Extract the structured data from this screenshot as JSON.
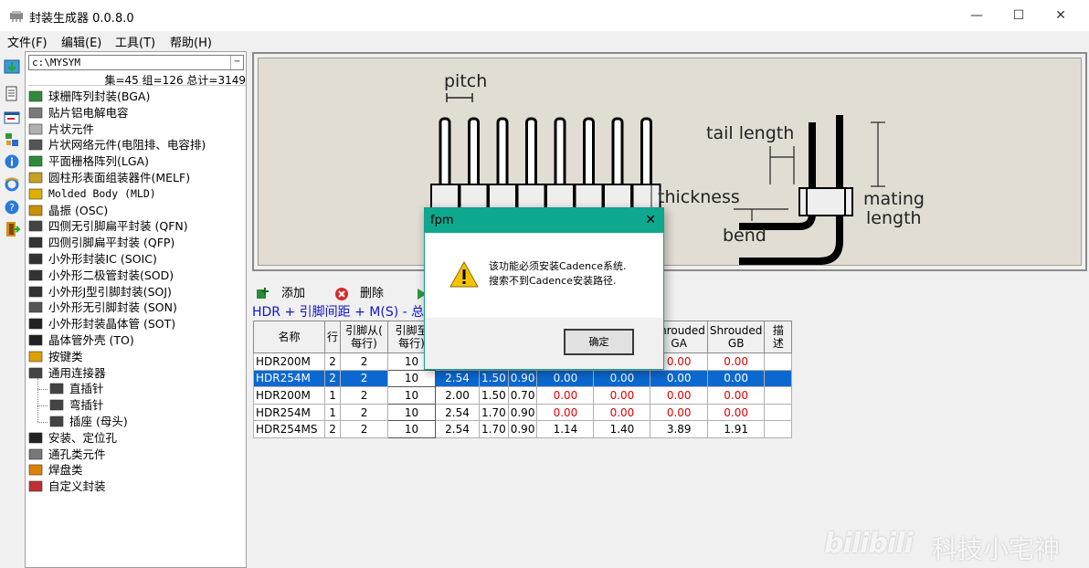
{
  "window": {
    "title": "封装生成器 0.0.8.0",
    "minimize": "—",
    "maximize": "☐",
    "close": "✕"
  },
  "menu": [
    "文件(F)",
    "编辑(E)",
    "工具(T)",
    "帮助(H)"
  ],
  "path": {
    "value": "c:\\MYSYM"
  },
  "stats": "集=45 组=126 总计=3149",
  "tree": [
    {
      "label": "球栅阵列封装(BGA)",
      "icon": "bga-icon",
      "color": "#2e8b3a"
    },
    {
      "label": "贴片铝电解电容",
      "icon": "capacitor-icon",
      "color": "#7a7a7a"
    },
    {
      "label": "片状元件",
      "icon": "chip-icon",
      "color": "#b0b0b0"
    },
    {
      "label": "片状网络元件(电阻排、电容排)",
      "icon": "network-icon",
      "color": "#555555"
    },
    {
      "label": "平面栅格阵列(LGA)",
      "icon": "lga-icon",
      "color": "#2e8b3a"
    },
    {
      "label": "圆柱形表面组装器件(MELF)",
      "icon": "melf-icon",
      "color": "#c8a020"
    },
    {
      "label": "Molded Body (MLD)",
      "icon": "molded-icon",
      "color": "#e0b000",
      "mono": true
    },
    {
      "label": "晶振 (OSC)",
      "icon": "osc-icon",
      "color": "#c89000"
    },
    {
      "label": "四侧无引脚扁平封装 (QFN)",
      "icon": "qfn-icon",
      "color": "#444444"
    },
    {
      "label": "四侧引脚扁平封装 (QFP)",
      "icon": "qfp-icon",
      "color": "#333333"
    },
    {
      "label": "小外形封装IC (SOIC)",
      "icon": "soic-icon",
      "color": "#333333"
    },
    {
      "label": "小外形二极管封装(SOD)",
      "icon": "sod-icon",
      "color": "#333333"
    },
    {
      "label": "小外形J型引脚封装(SOJ)",
      "icon": "soj-icon",
      "color": "#333333"
    },
    {
      "label": "小外形无引脚封装 (SON)",
      "icon": "son-icon",
      "color": "#555555"
    },
    {
      "label": "小外形封装晶体管 (SOT)",
      "icon": "sot-icon",
      "color": "#222222"
    },
    {
      "label": "晶体管外壳 (TO)",
      "icon": "to-icon",
      "color": "#222222"
    },
    {
      "label": "按键类",
      "icon": "button-icon",
      "color": "#e0a000"
    },
    {
      "label": "通用连接器",
      "icon": "connector-icon",
      "color": "#444444"
    },
    {
      "label": "直插针",
      "icon": "straight-pin-icon",
      "color": "#444444",
      "child": true
    },
    {
      "label": "弯插针",
      "icon": "bent-pin-icon",
      "color": "#444444",
      "child": true
    },
    {
      "label": "插座 (母头)",
      "icon": "socket-icon",
      "color": "#444444",
      "child": true
    },
    {
      "label": "安装、定位孔",
      "icon": "mounting-hole-icon",
      "color": "#222222"
    },
    {
      "label": "通孔类元件",
      "icon": "through-hole-icon",
      "color": "#777777"
    },
    {
      "label": "焊盘类",
      "icon": "pad-icon",
      "color": "#e08000"
    },
    {
      "label": "自定义封装",
      "icon": "custom-icon",
      "color": "#c03030"
    }
  ],
  "diagram": {
    "pitch": "pitch",
    "thickness": "thickness",
    "tail_length": "tail length",
    "mating_length": "mating\nlength",
    "mating": "mating",
    "length": "length",
    "bend": "bend"
  },
  "grid_toolbar": {
    "add": "添加",
    "delete": "删除"
  },
  "grid_caption": "HDR + 引脚间距 + M(S) - 总",
  "grid": {
    "headers": [
      "名称",
      "行",
      "引脚从(\n每行)",
      "引脚至\n每行)",
      "",
      "",
      "",
      "",
      "",
      "Shrouded\nGA",
      "Shrouded\nGB",
      "描\n述"
    ],
    "header_lines": [
      [
        "名称"
      ],
      [
        "行"
      ],
      [
        "引脚从(",
        "每行)"
      ],
      [
        "引脚至",
        "每行)"
      ],
      [
        ""
      ],
      [
        ""
      ],
      [
        ""
      ],
      [
        ""
      ],
      [
        ""
      ],
      [
        "Shrouded",
        "GA"
      ],
      [
        "Shrouded",
        "GB"
      ],
      [
        "描",
        "述"
      ]
    ],
    "rows": [
      [
        "HDR200M",
        "2",
        "2",
        "10",
        "",
        "",
        "",
        "",
        "",
        "0.00",
        "0.00",
        ""
      ],
      [
        "HDR254M",
        "2",
        "2",
        "10",
        "2.54",
        "1.50",
        "0.90",
        "0.00",
        "0.00",
        "0.00",
        "0.00",
        ""
      ],
      [
        "HDR200M",
        "1",
        "2",
        "10",
        "2.00",
        "1.50",
        "0.70",
        "0.00",
        "0.00",
        "0.00",
        "0.00",
        ""
      ],
      [
        "HDR254M",
        "1",
        "2",
        "10",
        "2.54",
        "1.70",
        "0.90",
        "0.00",
        "0.00",
        "0.00",
        "0.00",
        ""
      ],
      [
        "HDR254MS",
        "2",
        "2",
        "10",
        "2.54",
        "1.70",
        "0.90",
        "1.14",
        "1.40",
        "3.89",
        "1.91",
        ""
      ]
    ],
    "selected_row": 1,
    "red_cols": [
      7,
      8,
      9,
      10
    ]
  },
  "dialog": {
    "title": "fpm",
    "close": "✕",
    "line1": "该功能必须安装Cadence系统.",
    "line2": "搜索不到Cadence安装路径.",
    "ok": "确定"
  },
  "watermark": {
    "logo": "bilibili",
    "text": "科技小宅神"
  }
}
